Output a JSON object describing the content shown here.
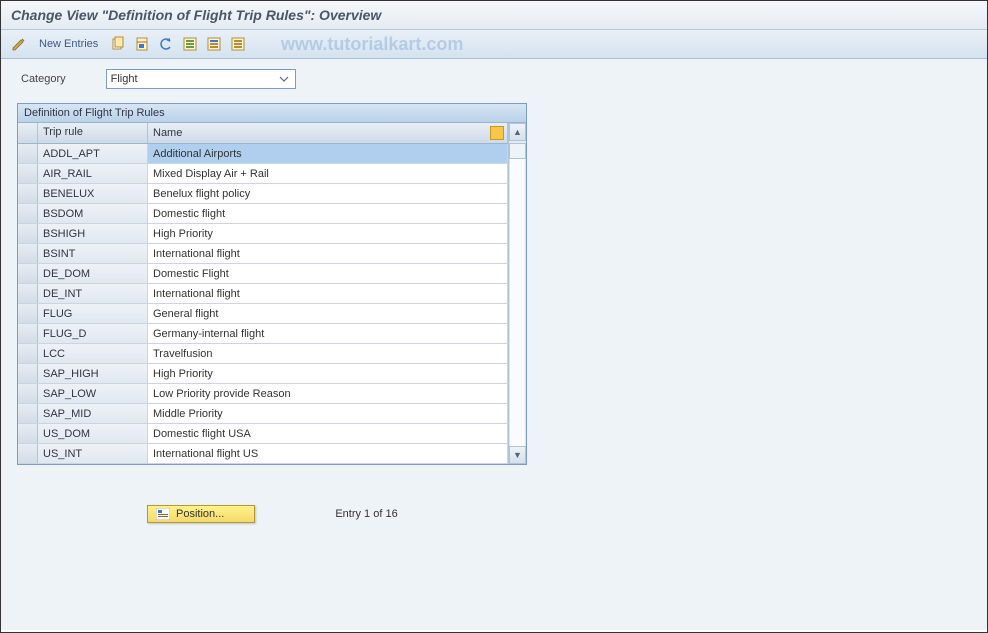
{
  "title": "Change View \"Definition of Flight Trip Rules\": Overview",
  "watermark": "www.tutorialkart.com",
  "toolbar": {
    "new_entries": "New Entries"
  },
  "category": {
    "label": "Category",
    "value": "Flight"
  },
  "panel": {
    "title": "Definition of Flight Trip Rules",
    "columns": {
      "rule": "Trip rule",
      "name": "Name"
    },
    "rows": [
      {
        "rule": "ADDL_APT",
        "name": "Additional Airports",
        "selected": true
      },
      {
        "rule": "AIR_RAIL",
        "name": "Mixed Display Air + Rail"
      },
      {
        "rule": "BENELUX",
        "name": "Benelux flight policy"
      },
      {
        "rule": "BSDOM",
        "name": "Domestic flight"
      },
      {
        "rule": "BSHIGH",
        "name": "High Priority"
      },
      {
        "rule": "BSINT",
        "name": "International flight"
      },
      {
        "rule": "DE_DOM",
        "name": "Domestic Flight"
      },
      {
        "rule": "DE_INT",
        "name": "International flight"
      },
      {
        "rule": "FLUG",
        "name": "General flight"
      },
      {
        "rule": "FLUG_D",
        "name": "Germany-internal flight"
      },
      {
        "rule": "LCC",
        "name": "Travelfusion"
      },
      {
        "rule": "SAP_HIGH",
        "name": "High Priority"
      },
      {
        "rule": "SAP_LOW",
        "name": "Low Priority provide Reason"
      },
      {
        "rule": "SAP_MID",
        "name": "Middle Priority"
      },
      {
        "rule": "US_DOM",
        "name": "Domestic flight USA"
      },
      {
        "rule": "US_INT",
        "name": "International flight US"
      }
    ]
  },
  "footer": {
    "position_label": "Position...",
    "entry_text": "Entry 1 of 16"
  }
}
